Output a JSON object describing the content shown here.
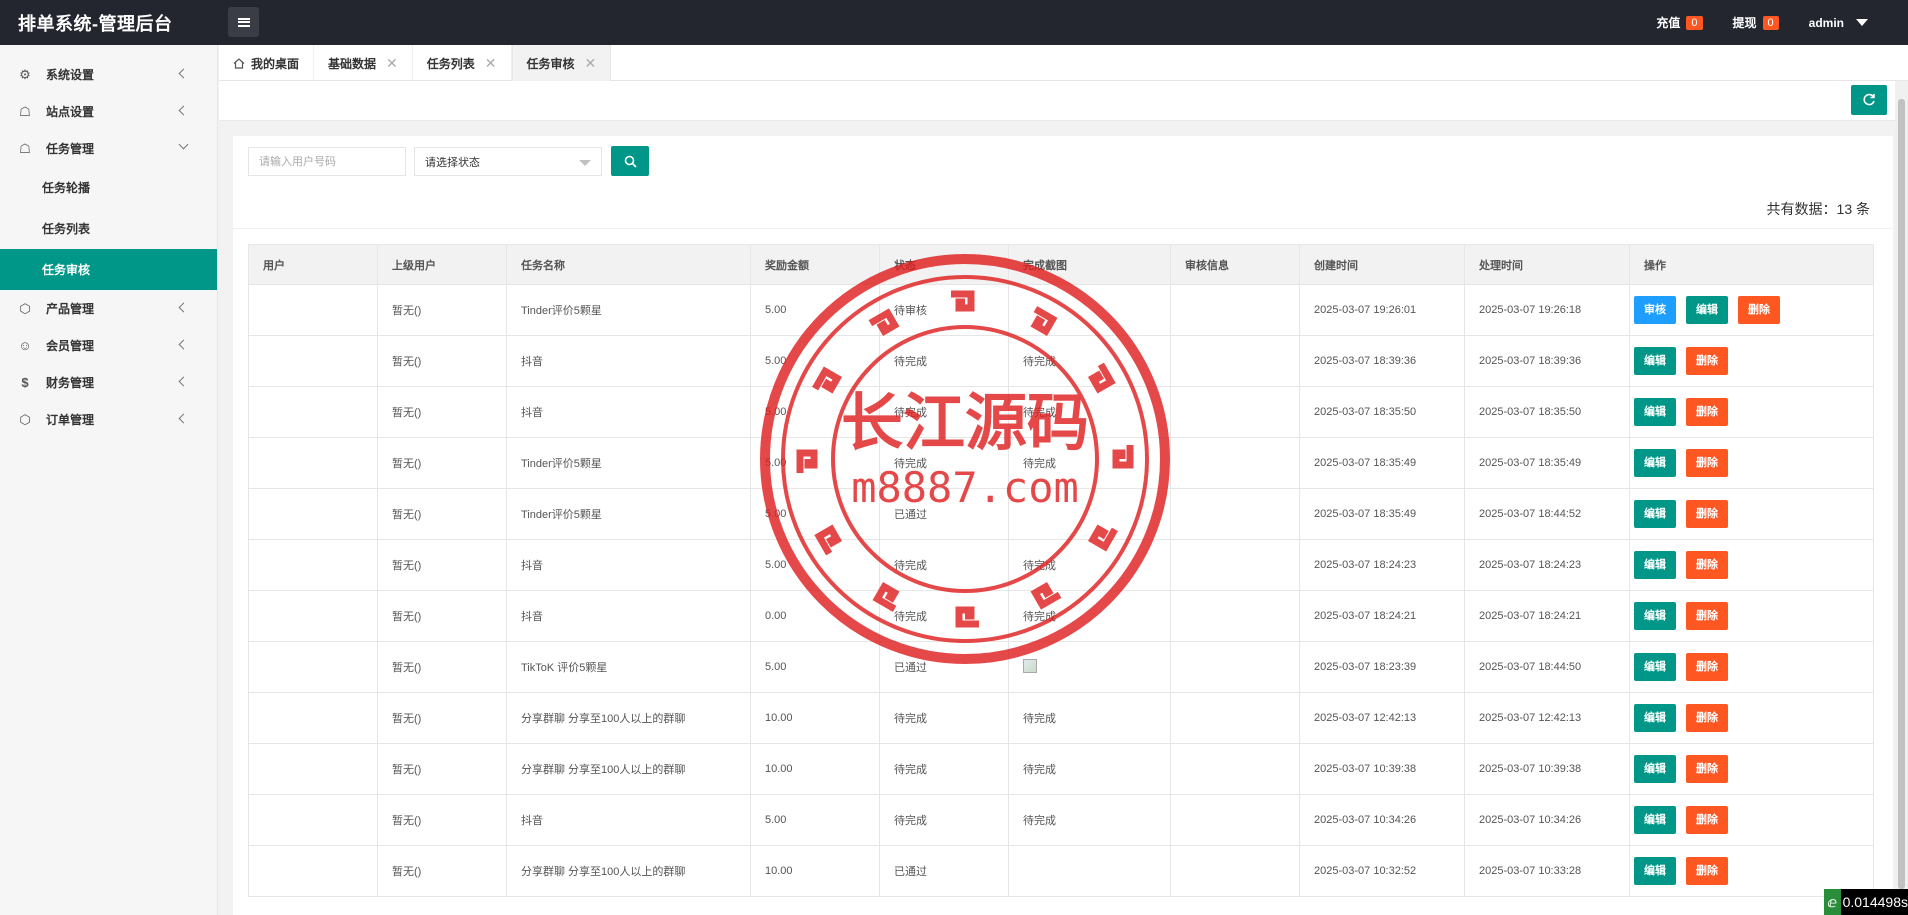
{
  "app": {
    "title": "排单系统-管理后台",
    "top_right": [
      {
        "label": "充值",
        "badge": "0"
      },
      {
        "label": "提现",
        "badge": "0"
      }
    ],
    "user": "admin"
  },
  "sidebar": {
    "items": [
      {
        "label": "系统设置",
        "icon": "gear-icon"
      },
      {
        "label": "站点设置",
        "icon": "site-icon"
      },
      {
        "label": "任务管理",
        "icon": "task-icon"
      },
      {
        "label": "产品管理",
        "icon": "product-icon"
      },
      {
        "label": "会员管理",
        "icon": "user-icon"
      },
      {
        "label": "财务管理",
        "icon": "dollar-icon"
      },
      {
        "label": "订单管理",
        "icon": "order-icon"
      }
    ],
    "sub_items": [
      "任务轮播",
      "任务列表",
      "任务审核"
    ]
  },
  "tabs": [
    {
      "label": "我的桌面"
    },
    {
      "label": "基础数据"
    },
    {
      "label": "任务列表"
    },
    {
      "label": "任务审核"
    }
  ],
  "search": {
    "user_placeholder": "请输入用户号码",
    "status_selected": "请选择状态"
  },
  "count_text": "共有数据：13 条",
  "table": {
    "headers": [
      "用户",
      "上级用户",
      "任务名称",
      "奖励金额",
      "状态",
      "完成截图",
      "审核信息",
      "创建时间",
      "处理时间",
      "操作"
    ],
    "rows": [
      {
        "user": "",
        "parent": "暂无()",
        "task": "Tinder评价5颗星",
        "amount": "5.00",
        "status": "待审核",
        "shot": "",
        "info": "",
        "created": "2025-03-07 19:26:01",
        "processed": "2025-03-07 19:26:18",
        "audit": true
      },
      {
        "user": "",
        "parent": "暂无()",
        "task": "抖音",
        "amount": "5.00",
        "status": "待完成",
        "shot": "待完成",
        "info": "",
        "created": "2025-03-07 18:39:36",
        "processed": "2025-03-07 18:39:36",
        "audit": false
      },
      {
        "user": "",
        "parent": "暂无()",
        "task": "抖音",
        "amount": "5.00",
        "status": "待完成",
        "shot": "待完成",
        "info": "",
        "created": "2025-03-07 18:35:50",
        "processed": "2025-03-07 18:35:50",
        "audit": false
      },
      {
        "user": "",
        "parent": "暂无()",
        "task": "Tinder评价5颗星",
        "amount": "5.00",
        "status": "待完成",
        "shot": "待完成",
        "info": "",
        "created": "2025-03-07 18:35:49",
        "processed": "2025-03-07 18:35:49",
        "audit": false
      },
      {
        "user": "",
        "parent": "暂无()",
        "task": "Tinder评价5颗星",
        "amount": "5.00",
        "status": "已通过",
        "shot": "",
        "info": "",
        "created": "2025-03-07 18:35:49",
        "processed": "2025-03-07 18:44:52",
        "audit": false
      },
      {
        "user": "",
        "parent": "暂无()",
        "task": "抖音",
        "amount": "5.00",
        "status": "待完成",
        "shot": "待完成",
        "info": "",
        "created": "2025-03-07 18:24:23",
        "processed": "2025-03-07 18:24:23",
        "audit": false
      },
      {
        "user": "",
        "parent": "暂无()",
        "task": "抖音",
        "amount": "0.00",
        "status": "待完成",
        "shot": "待完成",
        "info": "",
        "created": "2025-03-07 18:24:21",
        "processed": "2025-03-07 18:24:21",
        "audit": false
      },
      {
        "user": "",
        "parent": "暂无()",
        "task": "TikToK 评价5颗星",
        "amount": "5.00",
        "status": "已通过",
        "shot": "[img]",
        "info": "",
        "created": "2025-03-07 18:23:39",
        "processed": "2025-03-07 18:44:50",
        "audit": false
      },
      {
        "user": "",
        "parent": "暂无()",
        "task": "分享群聊 分享至100人以上的群聊",
        "amount": "10.00",
        "status": "待完成",
        "shot": "待完成",
        "info": "",
        "created": "2025-03-07 12:42:13",
        "processed": "2025-03-07 12:42:13",
        "audit": false
      },
      {
        "user": "",
        "parent": "暂无()",
        "task": "分享群聊 分享至100人以上的群聊",
        "amount": "10.00",
        "status": "待完成",
        "shot": "待完成",
        "info": "",
        "created": "2025-03-07 10:39:38",
        "processed": "2025-03-07 10:39:38",
        "audit": false
      },
      {
        "user": "",
        "parent": "暂无()",
        "task": "抖音",
        "amount": "5.00",
        "status": "待完成",
        "shot": "待完成",
        "info": "",
        "created": "2025-03-07 10:34:26",
        "processed": "2025-03-07 10:34:26",
        "audit": false
      },
      {
        "user": "",
        "parent": "暂无()",
        "task": "分享群聊 分享至100人以上的群聊",
        "amount": "10.00",
        "status": "已通过",
        "shot": "",
        "info": "",
        "created": "2025-03-07 10:32:52",
        "processed": "2025-03-07 10:33:28",
        "audit": false
      }
    ],
    "buttons": {
      "audit": "审核",
      "edit": "编辑",
      "delete": "删除"
    }
  },
  "watermark": {
    "title": "长江源码",
    "url": "m8887.com",
    "color": "#e02020"
  },
  "perf_text": "0.014498s",
  "colors": {
    "accent": "#009688",
    "danger": "#ff5722",
    "info": "#1e9fff",
    "topbar": "#23262e"
  }
}
